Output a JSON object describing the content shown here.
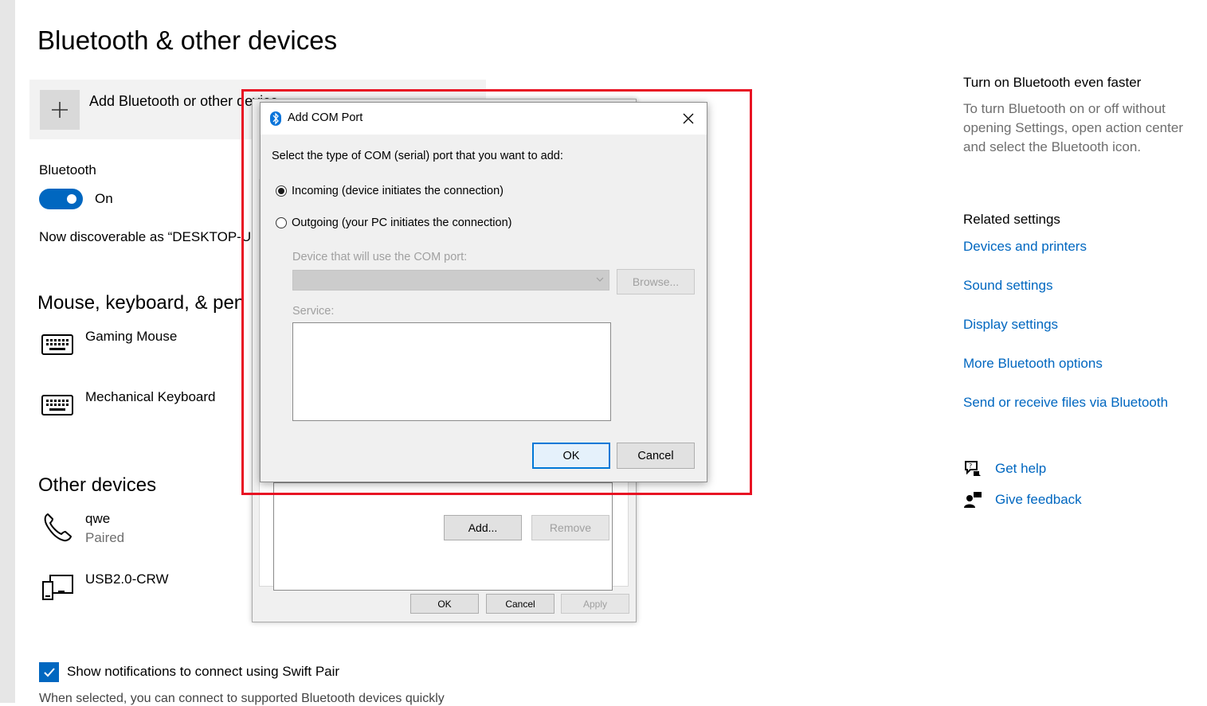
{
  "page": {
    "title": "Bluetooth & other devices",
    "add_device_label": "Add Bluetooth or other device",
    "bluetooth": {
      "label": "Bluetooth",
      "toggle_state": "On",
      "discoverable_text": "Now discoverable as “DESKTOP-UE"
    },
    "mouse_section": {
      "heading": "Mouse, keyboard, & pen",
      "devices": [
        {
          "name": "Gaming Mouse",
          "icon": "keyboard-icon"
        },
        {
          "name": "Mechanical Keyboard",
          "icon": "keyboard-icon"
        }
      ]
    },
    "other_section": {
      "heading": "Other devices",
      "devices": [
        {
          "name": "qwe",
          "status": "Paired",
          "icon": "phone-icon"
        },
        {
          "name": "USB2.0-CRW",
          "icon": "device-icon"
        }
      ]
    },
    "swift_pair": {
      "label": "Show notifications to connect using Swift Pair",
      "checked": true,
      "description": "When selected, you can connect to supported Bluetooth devices quickly"
    }
  },
  "right_panel": {
    "faster": {
      "heading": "Turn on Bluetooth even faster",
      "text": "To turn Bluetooth on or off without opening Settings, open action center and select the Bluetooth icon."
    },
    "related": {
      "heading": "Related settings",
      "links": [
        "Devices and printers",
        "Sound settings",
        "Display settings",
        "More Bluetooth options",
        "Send or receive files via Bluetooth"
      ]
    },
    "help": {
      "get_help": "Get help",
      "give_feedback": "Give feedback"
    }
  },
  "bg_dialog": {
    "add_button": "Add...",
    "remove_button": "Remove",
    "ok_button": "OK",
    "cancel_button": "Cancel",
    "apply_button": "Apply"
  },
  "com_dialog": {
    "title": "Add COM Port",
    "prompt": "Select the type of COM (serial) port that you want to add:",
    "incoming_label": "Incoming (device initiates the connection)",
    "outgoing_label": "Outgoing (your PC initiates the connection)",
    "selected": "incoming",
    "device_label": "Device that will use the COM port:",
    "browse_button": "Browse...",
    "service_label": "Service:",
    "ok_button": "OK",
    "cancel_button": "Cancel"
  },
  "colors": {
    "accent": "#0067c0",
    "highlight": "#e81123",
    "dialog_bg": "#f0f0f0",
    "muted_text": "#6e6e6e"
  }
}
